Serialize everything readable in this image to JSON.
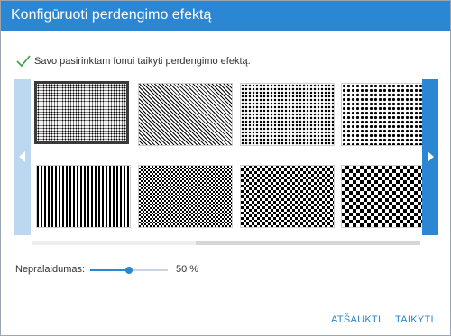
{
  "dialog": {
    "title": "Konfigūruoti perdengimo efektą",
    "apply_to_background_label": "Savo pasirinktam fonui taikyti perdengimo efektą.",
    "apply_to_background_checked": true,
    "check_icon": "check-icon",
    "opacity": {
      "label": "Nepralaidumas:",
      "value_text": "50 %",
      "value_fraction": 0.5
    },
    "buttons": {
      "cancel": "ATŠAUKTI",
      "apply": "TAIKYTI"
    },
    "nav": {
      "prev_icon": "chevron-left-icon",
      "next_icon": "chevron-right-icon"
    },
    "patterns": [
      {
        "id": "dots-fine",
        "selected": true
      },
      {
        "id": "diagonal-lines",
        "selected": false
      },
      {
        "id": "dots-medium",
        "selected": false
      },
      {
        "id": "dots-large",
        "selected": false
      },
      {
        "id": "vertical-lines",
        "selected": false
      },
      {
        "id": "checker-fine",
        "selected": false
      },
      {
        "id": "checker-medium",
        "selected": false
      },
      {
        "id": "checker-large",
        "selected": false
      }
    ],
    "gallery_scroll_fraction": 0.42,
    "colors": {
      "accent": "#2b86d3",
      "nav_disabled": "#bcd8f0",
      "title_text": "#ffffff"
    }
  }
}
